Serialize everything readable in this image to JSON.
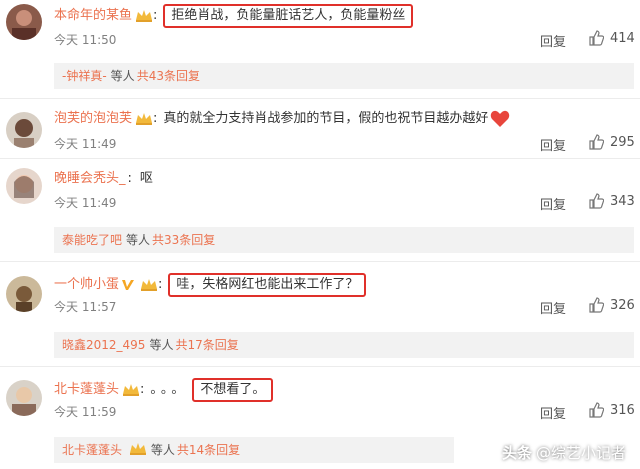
{
  "comments": [
    {
      "user": "本命年的某鱼",
      "text": "拒绝肖战，负能量脏话艺人，负能量粉丝",
      "time": "今天 11:50",
      "reply": "回复",
      "likes": "414",
      "sub": {
        "name": "-钟祥真-",
        "etc": "等人",
        "total": "共43条回复"
      }
    },
    {
      "user": "泡芙的泡泡芙",
      "text": "真的就全力支持肖战参加的节目，假的也祝节目越办越好",
      "time": "今天 11:49",
      "reply": "回复",
      "likes": "295"
    },
    {
      "user": "晚睡会秃头_",
      "text": "呕",
      "time": "今天 11:49",
      "reply": "回复",
      "likes": "343",
      "sub": {
        "name": "泰能吃了吧",
        "etc": "等人",
        "total": "共33条回复"
      }
    },
    {
      "user": "一个帅小蛋",
      "text": "哇，失格网红也能出来工作了？",
      "time": "今天 11:57",
      "reply": "回复",
      "likes": "326",
      "sub": {
        "name": "晓鑫2012_495",
        "etc": "等人",
        "total": "共17条回复"
      }
    },
    {
      "user": "北卡蓬蓬头",
      "text": "不想看了。",
      "prefix": "。。。",
      "time": "今天 11:59",
      "reply": "回复",
      "likes": "316",
      "sub": {
        "name": "北卡蓬蓬头",
        "etc": "等人",
        "total": "共14条回复"
      }
    }
  ],
  "watermark": {
    "brand": "头条",
    "handle": "@综艺小记者"
  },
  "colors": {
    "username": "#eb7350",
    "highlight_box": "#e0302a",
    "heart": "#e8453c"
  }
}
